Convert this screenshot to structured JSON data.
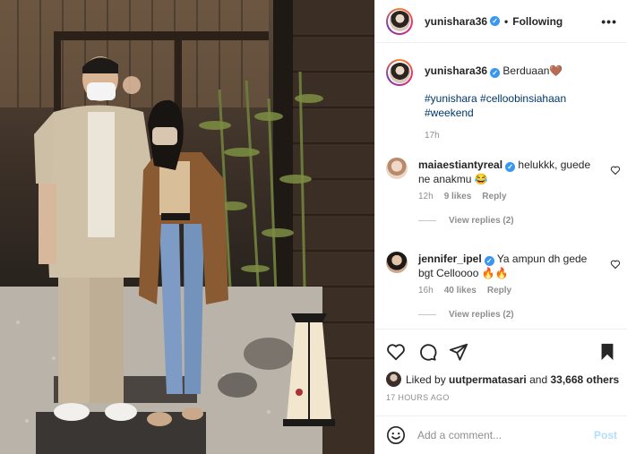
{
  "header": {
    "username": "yunishara36",
    "separator": "•",
    "follow_status": "Following",
    "more_label": "•••"
  },
  "caption": {
    "username": "yunishara36",
    "text": "Berduaan🤎",
    "hashtags_line1": "#yunishara #celloobinsiahaan",
    "hashtags_line2": "#weekend",
    "time": "17h"
  },
  "comments": [
    {
      "username": "maiaestiantyreal",
      "text": "helukkk, guede ne anakmu 😂",
      "time": "12h",
      "likes": "9 likes",
      "reply": "Reply",
      "view_replies": "View replies (2)"
    },
    {
      "username": "jennifer_ipel",
      "text": "Ya ampun dh gede bgt Celloooo 🔥🔥",
      "time": "16h",
      "likes": "40 likes",
      "reply": "Reply",
      "view_replies": "View replies (2)"
    }
  ],
  "likes": {
    "prefix": "Liked by",
    "user": "uutpermatasari",
    "and": "and",
    "others": "33,668 others"
  },
  "post_time": "17 HOURS AGO",
  "add_comment": {
    "placeholder": "Add a comment...",
    "post_label": "Post"
  },
  "colors": {
    "link": "#00376b",
    "verified": "#3897f0",
    "muted": "#8e8e8e",
    "post_disabled": "#b2dffc"
  }
}
